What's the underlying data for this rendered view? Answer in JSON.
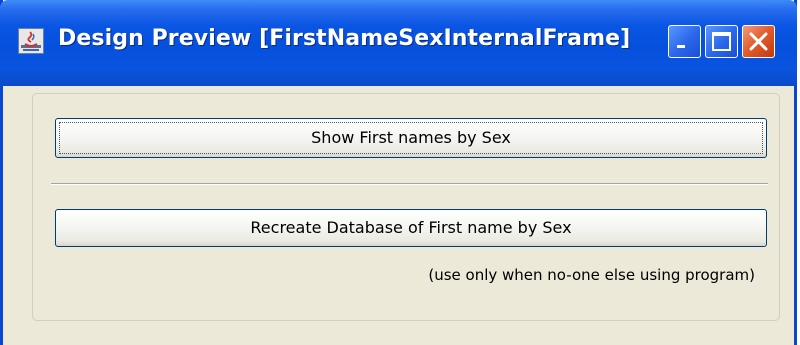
{
  "window": {
    "title": "Design Preview [FirstNameSexInternalFrame]",
    "icon": "java-app-icon",
    "controls": {
      "minimize_icon": "minimize-icon",
      "maximize_icon": "maximize-icon",
      "close_icon": "close-icon"
    }
  },
  "panel": {
    "show_button_label": "Show First names by Sex",
    "recreate_button_label": "Recreate Database of First name by Sex",
    "note": "(use only when no-one else using program)"
  },
  "colors": {
    "titlebar": "#0550dc",
    "window_bg": "#ece9d8",
    "close_button": "#e05a2a",
    "button_border": "#003c74"
  }
}
